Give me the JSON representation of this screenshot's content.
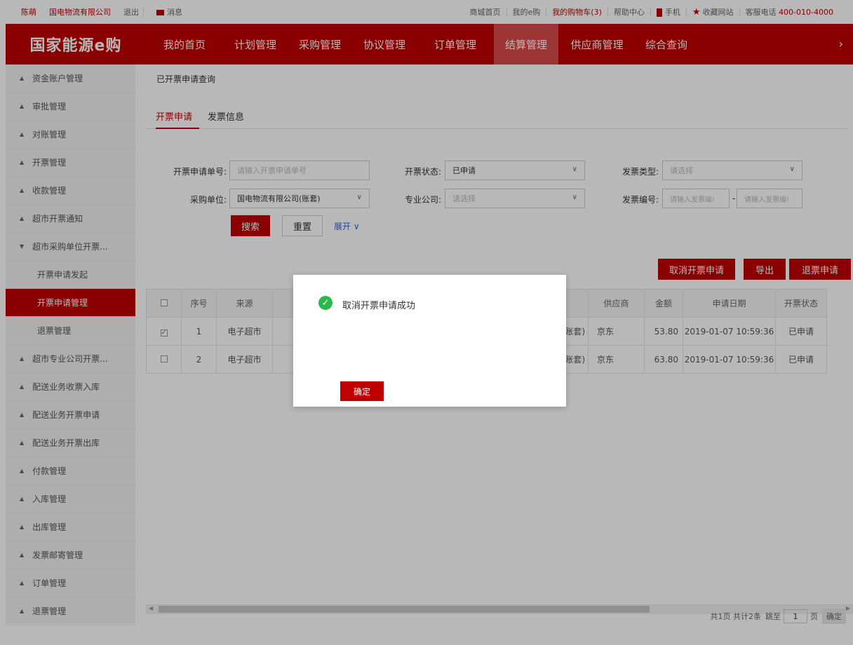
{
  "topbar": {
    "user": "陈萌",
    "company": "国电物流有限公司",
    "logout": "退出",
    "messages": "消息",
    "links": [
      "商城首页",
      "我的e购",
      "我的购物车(3)",
      "帮助中心"
    ],
    "phone": "手机",
    "favorite": "收藏网站",
    "hotline_label": "客服电话",
    "hotline_number": "400-010-4000"
  },
  "nav": {
    "logo": "国家能源e购",
    "items": [
      "我的首页",
      "计划管理",
      "采购管理",
      "协议管理",
      "订单管理",
      "结算管理",
      "供应商管理",
      "综合查询"
    ],
    "active_index": 5,
    "more": "›"
  },
  "sidebar": {
    "items": [
      {
        "label": "资金账户管理",
        "tri": "▲"
      },
      {
        "label": "审批管理",
        "tri": "▲"
      },
      {
        "label": "对账管理",
        "tri": "▲"
      },
      {
        "label": "开票管理",
        "tri": "▲"
      },
      {
        "label": "收款管理",
        "tri": "▲"
      },
      {
        "label": "超市开票通知",
        "tri": "▲"
      },
      {
        "label": "超市采购单位开票...",
        "tri": "▼"
      },
      {
        "label": "开票申请发起",
        "tri": ""
      },
      {
        "label": "开票申请管理",
        "tri": ""
      },
      {
        "label": "退票管理",
        "tri": ""
      },
      {
        "label": "超市专业公司开票...",
        "tri": "▲"
      },
      {
        "label": "配送业务收票入库",
        "tri": "▲"
      },
      {
        "label": "配送业务开票申请",
        "tri": "▲"
      },
      {
        "label": "配送业务开票出库",
        "tri": "▲"
      },
      {
        "label": "付款管理",
        "tri": "▲"
      },
      {
        "label": "入库管理",
        "tri": "▲"
      },
      {
        "label": "出库管理",
        "tri": "▲"
      },
      {
        "label": "发票邮寄管理",
        "tri": "▲"
      },
      {
        "label": "订单管理",
        "tri": "▲"
      },
      {
        "label": "退票管理",
        "tri": "▲"
      }
    ]
  },
  "breadcrumb": "已开票申请查询",
  "tabs": [
    "开票申请",
    "发票信息"
  ],
  "form": {
    "apply_no_label": "开票申请单号:",
    "apply_no_placeholder": "请输入开票申请单号",
    "status_label": "开票状态:",
    "status_value": "已申请",
    "invoice_type_label": "发票类型:",
    "invoice_type_value": "请选择",
    "buyer_label": "采购单位:",
    "buyer_value": "国电物流有限公司(账套)",
    "company_label": "专业公司:",
    "company_value": "请选择",
    "invoice_no_label": "发票编号:",
    "invoice_no_from": "请输入发票编!",
    "invoice_no_to": "请输入发票编!",
    "search": "搜索",
    "reset": "重置",
    "expand": "展开 ∨"
  },
  "actions": {
    "cancel_apply": "取消开票申请",
    "export": "导出",
    "refund_apply": "退票申请"
  },
  "table": {
    "headers": [
      "序号",
      "来源",
      "供应商",
      "金额",
      "申请日期",
      "开票状态"
    ],
    "rows": [
      {
        "checked": true,
        "no": "1",
        "source": "电子超市",
        "account": "账套)",
        "supplier": "京东",
        "amount": "53.80",
        "date": "2019-01-07 10:59:36",
        "status": "已申请"
      },
      {
        "checked": false,
        "no": "2",
        "source": "电子超市",
        "account": "账套)",
        "supplier": "京东",
        "amount": "63.80",
        "date": "2019-01-07 10:59:36",
        "status": "已申请"
      }
    ]
  },
  "pager": {
    "summary": "共1页 共计2条",
    "goto": "跳至",
    "page": "1",
    "unit": "页",
    "confirm": "确定"
  },
  "dialog": {
    "message": "取消开票申请成功",
    "confirm": "确定"
  }
}
